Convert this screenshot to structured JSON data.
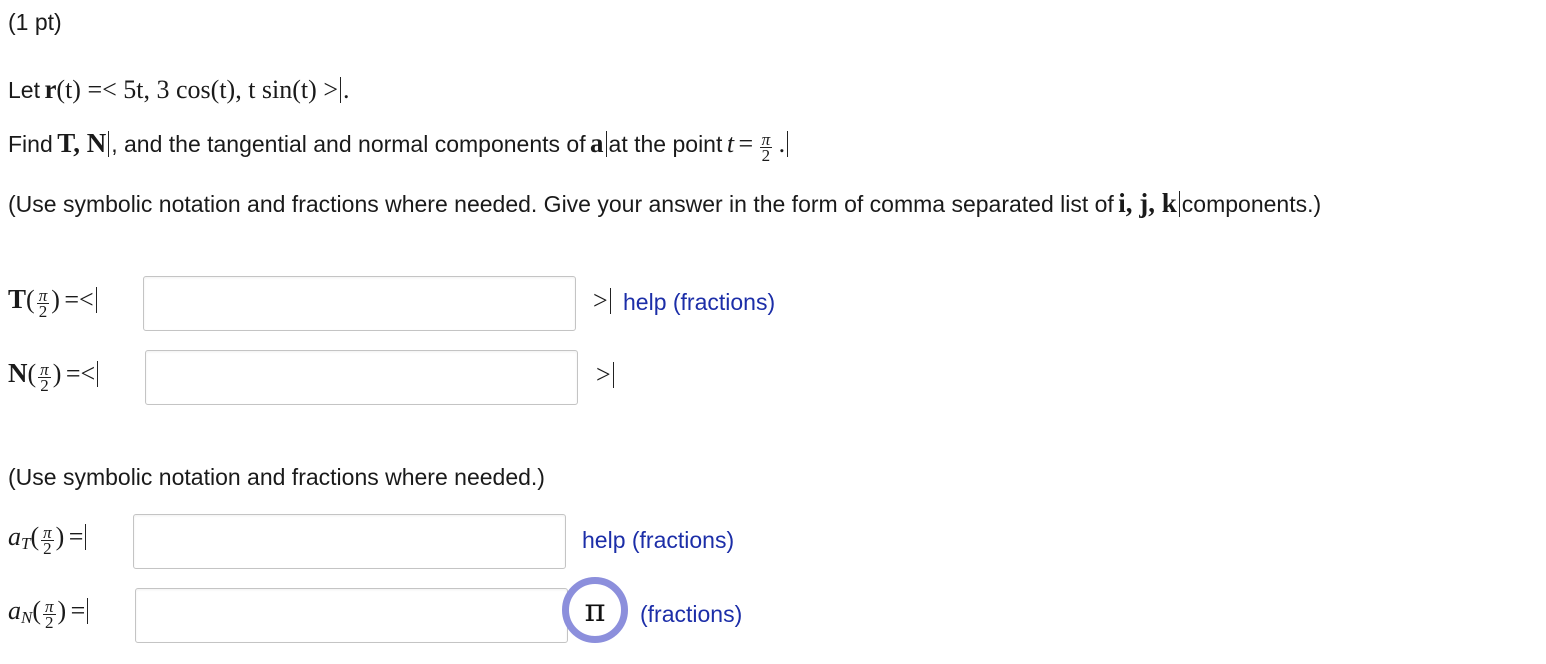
{
  "header": {
    "points": "(1 pt)"
  },
  "problem": {
    "let_word": "Let",
    "r_symbol": "r",
    "r_arg": "(t) =< 5t,  3 cos(t),  t sin(t) >",
    "find_word": "Find",
    "tn_symbols": "T,  N",
    "find_text_1": ", and the tangential and normal components of",
    "a_symbol": "a",
    "find_text_2": "at the point",
    "t_var": "t",
    "equals": "=",
    "pi_sym": "π",
    "two": "2",
    "period": ".",
    "instructions_1": "(Use symbolic notation and fractions where needed. Give your answer in the form of comma separated list of",
    "ijk": "i,  j,  k",
    "instructions_1_end": "components.)"
  },
  "answers": {
    "T_label": "T",
    "N_label": "N",
    "open_paren": "(",
    "close_paren": ")",
    "vec_open": "=<",
    "vec_close": ">",
    "help_fractions": "help (fractions)",
    "instructions_2": "(Use symbolic notation and fractions where needed.)",
    "aT_label": "a",
    "aT_sub": "T",
    "aN_label": "a",
    "aN_sub": "N",
    "scalar_eq": "=",
    "help_fractions_2": "help (fractions)",
    "fractions_only": "(fractions)",
    "pi_button": "π",
    "T_value": "",
    "N_value": "",
    "aT_value": "",
    "aN_value": ""
  }
}
